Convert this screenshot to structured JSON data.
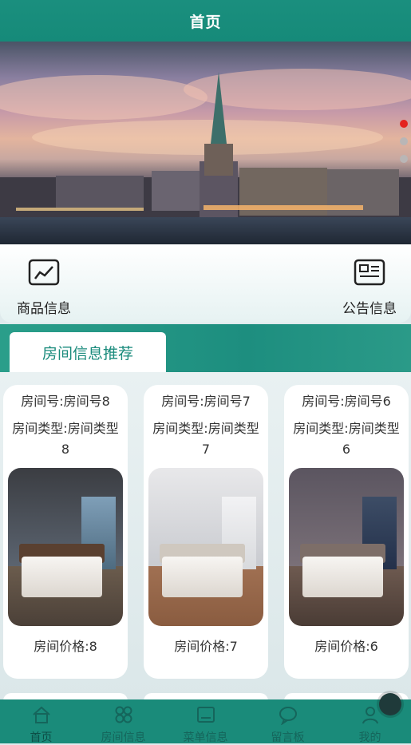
{
  "header": {
    "title": "首页"
  },
  "banner": {
    "dots": 3,
    "active_dot": 0
  },
  "shortcuts": [
    {
      "label": "商品信息",
      "icon": "chart-icon"
    },
    {
      "label": "公告信息",
      "icon": "news-icon"
    }
  ],
  "recommend": {
    "tab_label": "房间信息推荐"
  },
  "rooms": [
    {
      "number": "房间号:房间号8",
      "type": "房间类型:房间类型8",
      "price": "房间价格:8"
    },
    {
      "number": "房间号:房间号7",
      "type": "房间类型:房间类型7",
      "price": "房间价格:7"
    },
    {
      "number": "房间号:房间号6",
      "type": "房间类型:房间类型6",
      "price": "房间价格:6"
    }
  ],
  "tabbar": [
    {
      "label": "首页",
      "icon": "home-icon",
      "active": true
    },
    {
      "label": "房间信息",
      "icon": "grid-icon"
    },
    {
      "label": "菜单信息",
      "icon": "menu-card-icon"
    },
    {
      "label": "留言板",
      "icon": "chat-icon"
    },
    {
      "label": "我的",
      "icon": "user-icon"
    }
  ],
  "colors": {
    "primary": "#1a8b7a",
    "tab_text": "#1a8b7c",
    "active_dot": "#e4231f"
  }
}
